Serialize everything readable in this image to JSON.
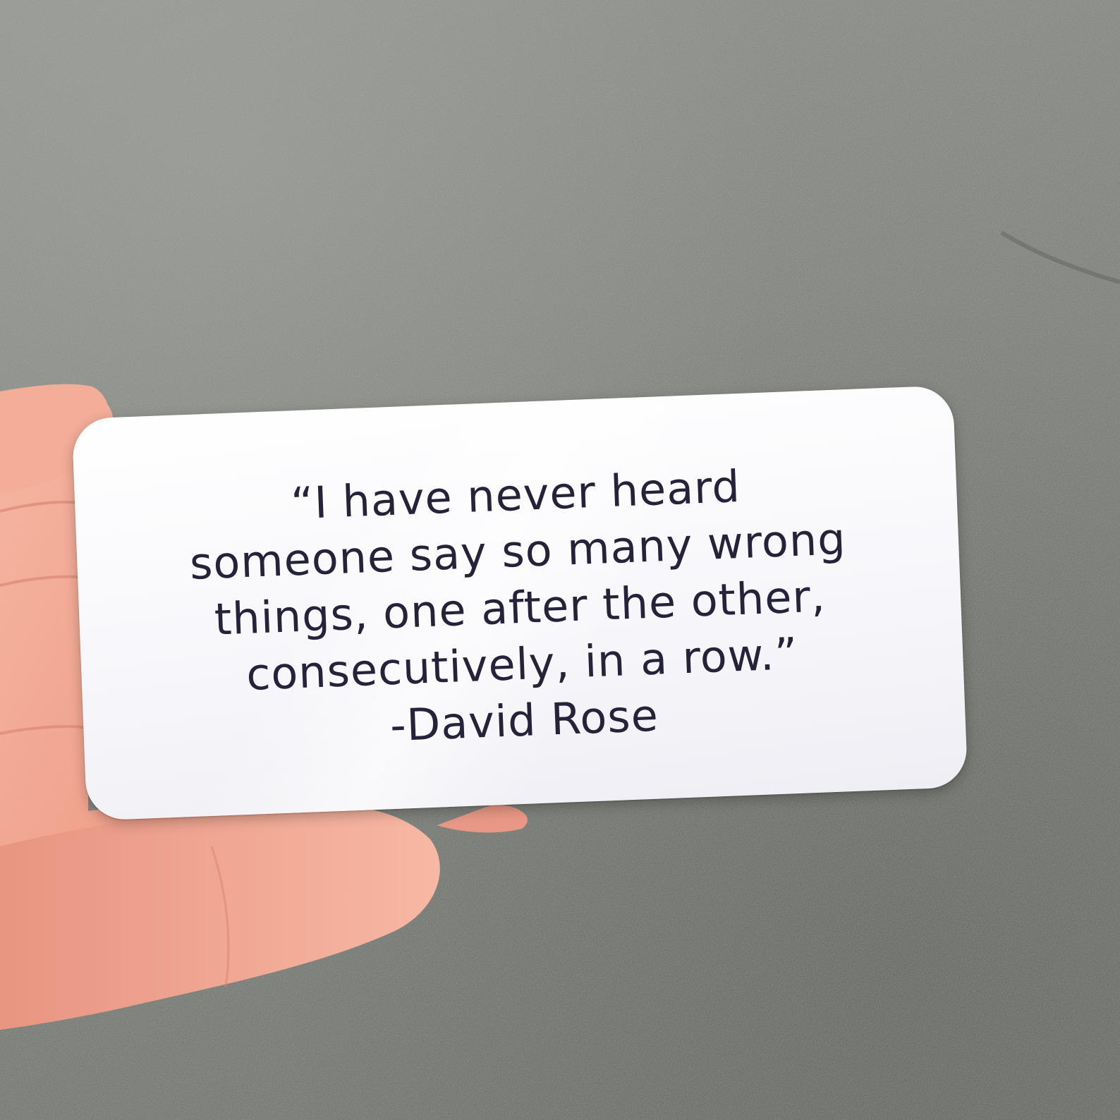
{
  "sticker": {
    "lines": [
      "“I have never heard",
      "someone say so many wrong",
      "things, one after the other,",
      "consecutively, in a row.”",
      "-David Rose"
    ]
  },
  "colors": {
    "background": "#80837d",
    "sticker": "#f7f7fb",
    "text": "#25233a",
    "skin": "#f0a792"
  }
}
